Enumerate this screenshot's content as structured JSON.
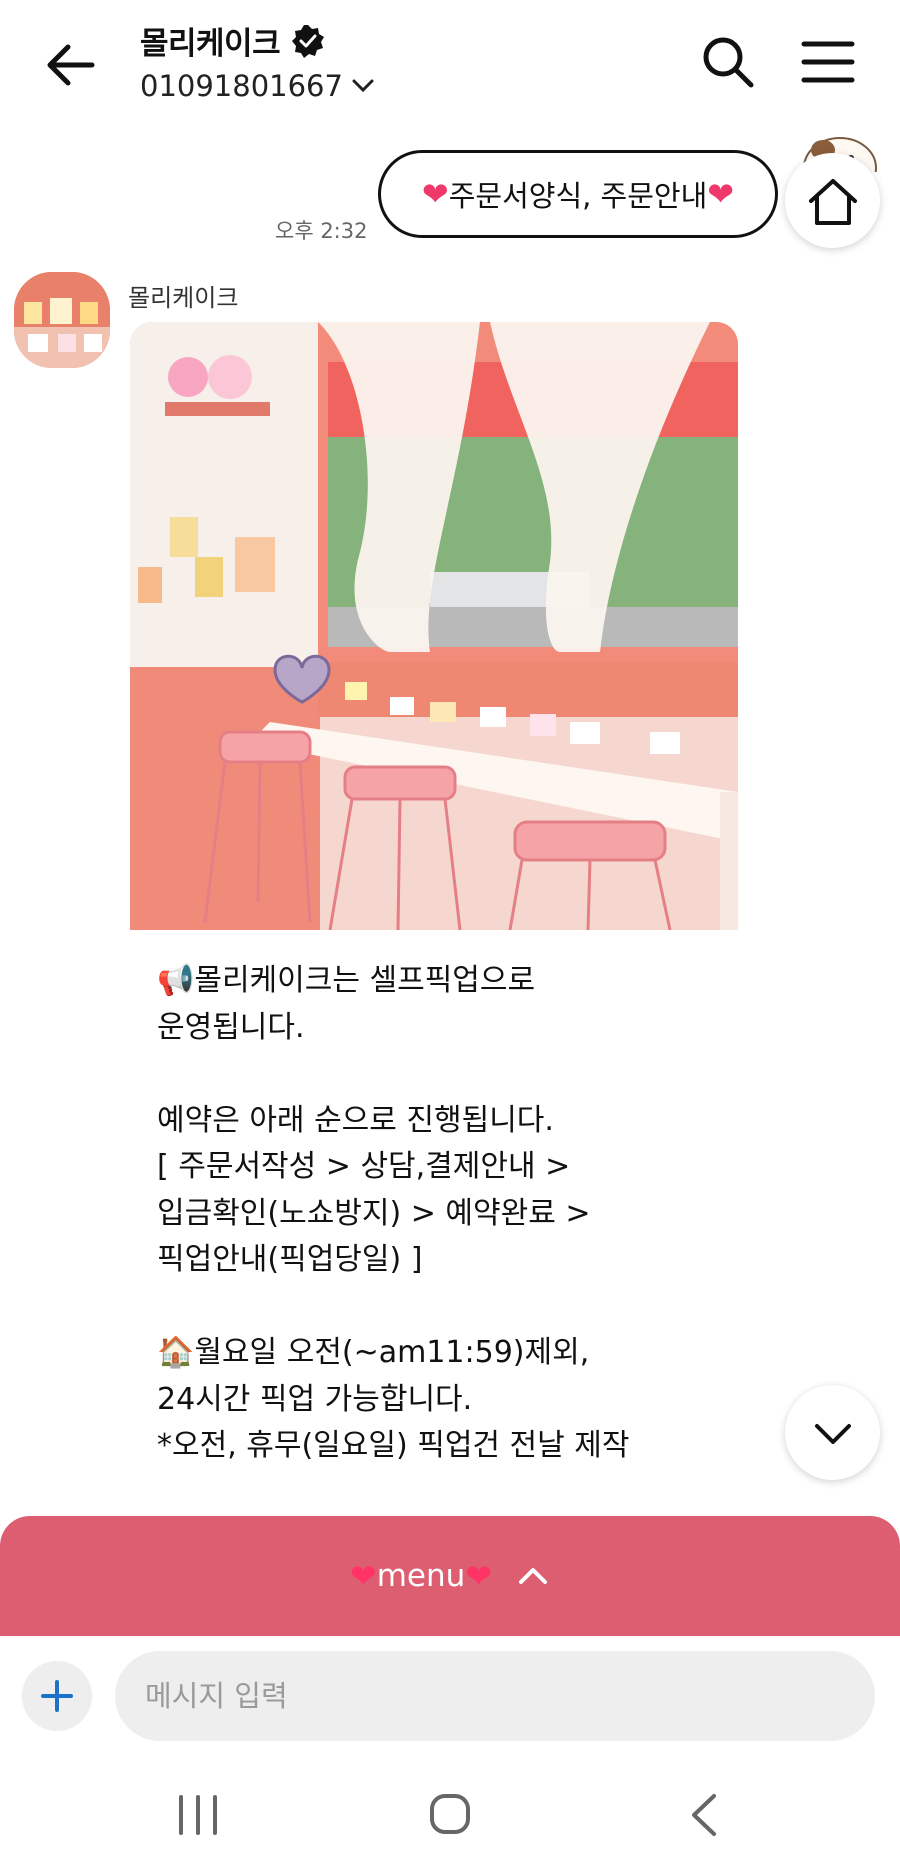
{
  "header": {
    "title": "몰리케이크",
    "phone": "01091801667",
    "icons": {
      "back": "arrow-left-icon",
      "verified": "verified-badge-icon",
      "dropdown": "chevron-down-icon",
      "search": "search-icon",
      "menu": "hamburger-menu-icon"
    }
  },
  "sent_message": {
    "text": "주문서양식, 주문안내",
    "prefix_emoji": "❤",
    "suffix_emoji": "❤",
    "time": "오후 2:32"
  },
  "received_message": {
    "sender": "몰리케이크",
    "image_icon": "cafe-photo",
    "text": "📢몰리케이크는 셀프픽업으로\n운영됩니다.\n\n예약은 아래 순으로 진행됩니다.\n[ 주문서작성 > 상담,결제안내 >\n입금확인(노쇼방지) > 예약완료 >\n픽업안내(픽업당일) ]\n\n🏠월요일 오전(~am11:59)제외,\n24시간 픽업 가능합니다.\n*오전, 휴무(일요일) 픽업건 전날 제작"
  },
  "floating": {
    "home_icon": "home-icon",
    "scroll_down_icon": "chevron-down-icon"
  },
  "menu_bar": {
    "label": "menu",
    "prefix_emoji": "❤",
    "suffix_emoji": "❤",
    "chevron": "chevron-up-icon"
  },
  "input": {
    "placeholder": "메시지 입력",
    "value": "",
    "plus_icon": "plus-icon"
  },
  "colors": {
    "menu_bar": "#dd5d71",
    "heart": "#f0386b",
    "plus_icon": "#1a73c9",
    "input_bg": "#eeeeee"
  }
}
